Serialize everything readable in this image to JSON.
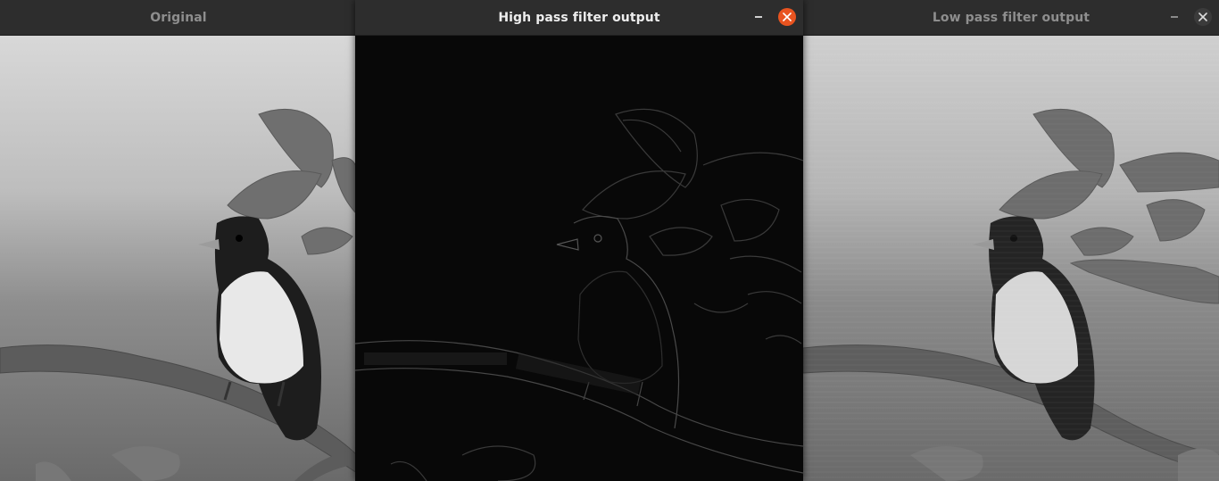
{
  "windows": {
    "original": {
      "title": "Original"
    },
    "high_pass": {
      "title": "High pass filter output"
    },
    "low_pass": {
      "title": "Low pass filter output"
    }
  },
  "colors": {
    "titlebar_bg": "#2d2d2d",
    "active_title": "#ededed",
    "inactive_title": "#8e8e8e",
    "close_button_active": "#e95420"
  },
  "icons": {
    "minimize": "minimize-icon",
    "close": "close-icon"
  }
}
